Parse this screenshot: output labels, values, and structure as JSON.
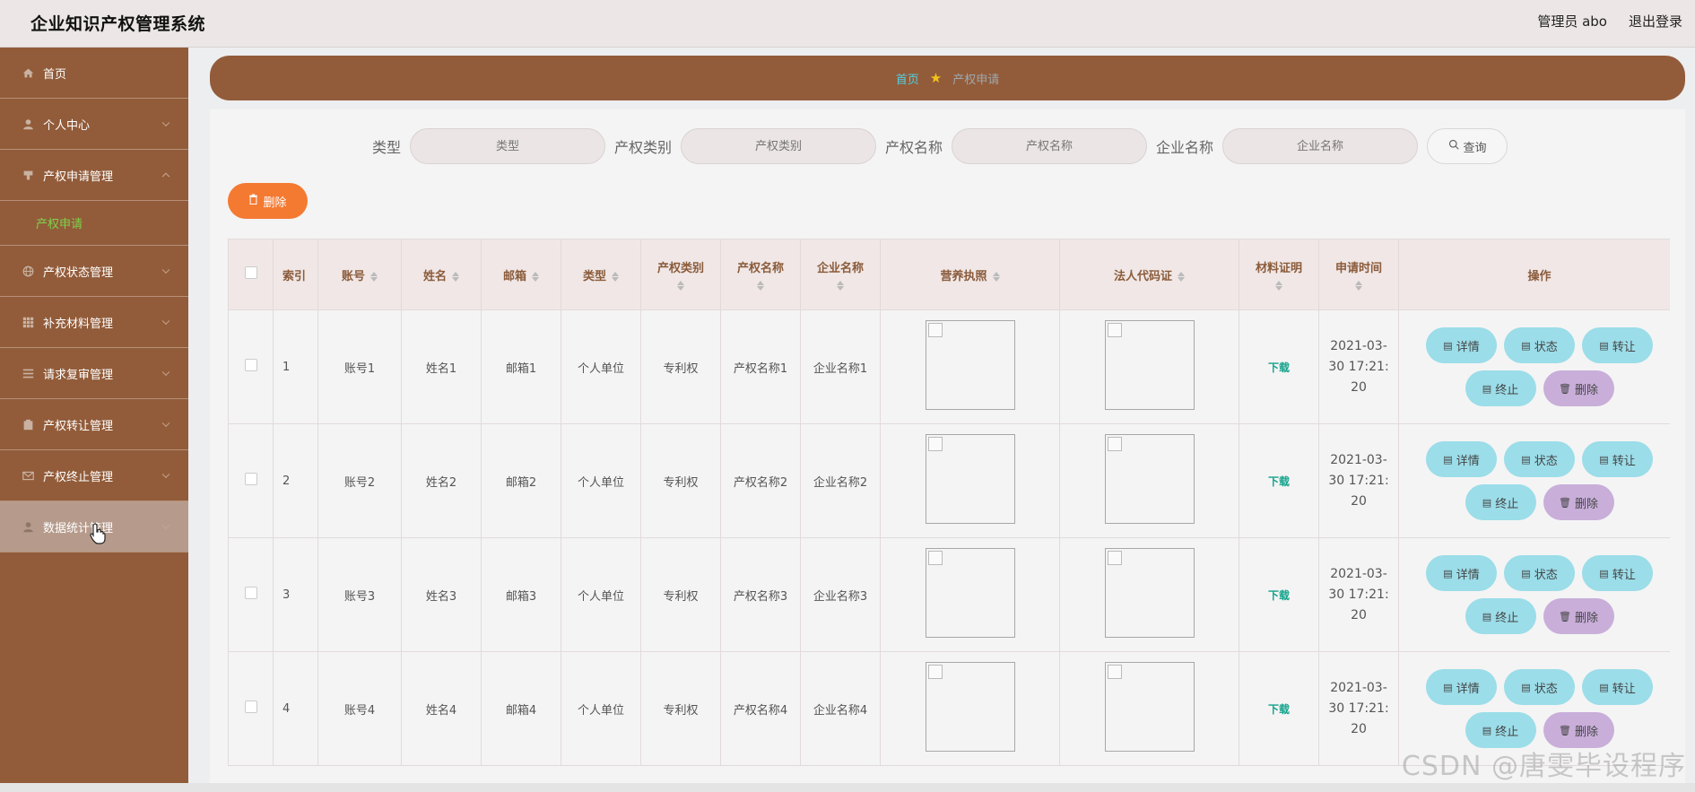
{
  "header": {
    "title": "企业知识产权管理系统",
    "admin_label": "管理员 abo",
    "logout_label": "退出登录"
  },
  "sidebar": {
    "items": [
      {
        "label": "首页",
        "icon": "home-icon"
      },
      {
        "label": "个人中心",
        "icon": "user-icon"
      },
      {
        "label": "产权申请管理",
        "icon": "stamp-icon"
      },
      {
        "label": "产权状态管理",
        "icon": "globe-icon"
      },
      {
        "label": "补充材料管理",
        "icon": "grid-icon"
      },
      {
        "label": "请求复审管理",
        "icon": "list-icon"
      },
      {
        "label": "产权转让管理",
        "icon": "clipboard-icon"
      },
      {
        "label": "产权终止管理",
        "icon": "mail-icon"
      },
      {
        "label": "数据统计管理",
        "icon": "user-icon"
      }
    ],
    "submenu_label": "产权申请"
  },
  "breadcrumb": {
    "home": "首页",
    "current": "产权申请"
  },
  "search": {
    "type_label": "类型",
    "type_placeholder": "类型",
    "category_label": "产权类别",
    "category_placeholder": "产权类别",
    "name_label": "产权名称",
    "name_placeholder": "产权名称",
    "company_label": "企业名称",
    "company_placeholder": "企业名称",
    "query_label": "查询"
  },
  "toolbar": {
    "delete_label": "删除"
  },
  "table": {
    "headers": {
      "index": "索引",
      "account": "账号",
      "name": "姓名",
      "email": "邮箱",
      "type": "类型",
      "category": "产权类别",
      "ip_name": "产权名称",
      "company": "企业名称",
      "license": "营养执照",
      "legal_code": "法人代码证",
      "material": "材料证明",
      "apply_time": "申请时间",
      "actions": "操作"
    },
    "rows": [
      {
        "index": "1",
        "account": "账号1",
        "name": "姓名1",
        "email": "邮箱1",
        "type": "个人单位",
        "category": "专利权",
        "ip_name": "产权名称1",
        "company": "企业名称1",
        "material": "下载",
        "time_line1": "2021-03-",
        "time_line2": "30 17:21:",
        "time_line3": "20"
      },
      {
        "index": "2",
        "account": "账号2",
        "name": "姓名2",
        "email": "邮箱2",
        "type": "个人单位",
        "category": "专利权",
        "ip_name": "产权名称2",
        "company": "企业名称2",
        "material": "下载",
        "time_line1": "2021-03-",
        "time_line2": "30 17:21:",
        "time_line3": "20"
      },
      {
        "index": "3",
        "account": "账号3",
        "name": "姓名3",
        "email": "邮箱3",
        "type": "个人单位",
        "category": "专利权",
        "ip_name": "产权名称3",
        "company": "企业名称3",
        "material": "下载",
        "time_line1": "2021-03-",
        "time_line2": "30 17:21:",
        "time_line3": "20"
      },
      {
        "index": "4",
        "account": "账号4",
        "name": "姓名4",
        "email": "邮箱4",
        "type": "个人单位",
        "category": "专利权",
        "ip_name": "产权名称4",
        "company": "企业名称4",
        "material": "下载",
        "time_line1": "2021-03-",
        "time_line2": "30 17:21:",
        "time_line3": "20"
      }
    ],
    "actions": {
      "detail": "详情",
      "status": "状态",
      "transfer": "转让",
      "terminate": "终止",
      "delete": "删除"
    }
  },
  "watermark": "CSDN @唐雯毕设程序",
  "colors": {
    "sidebar_bg": "#925c3a",
    "header_bg": "#ece6e6",
    "accent_orange": "#f47a32",
    "action_cyan": "#9bdde9",
    "action_purple": "#c8aed9",
    "link_green": "#14a38c"
  }
}
